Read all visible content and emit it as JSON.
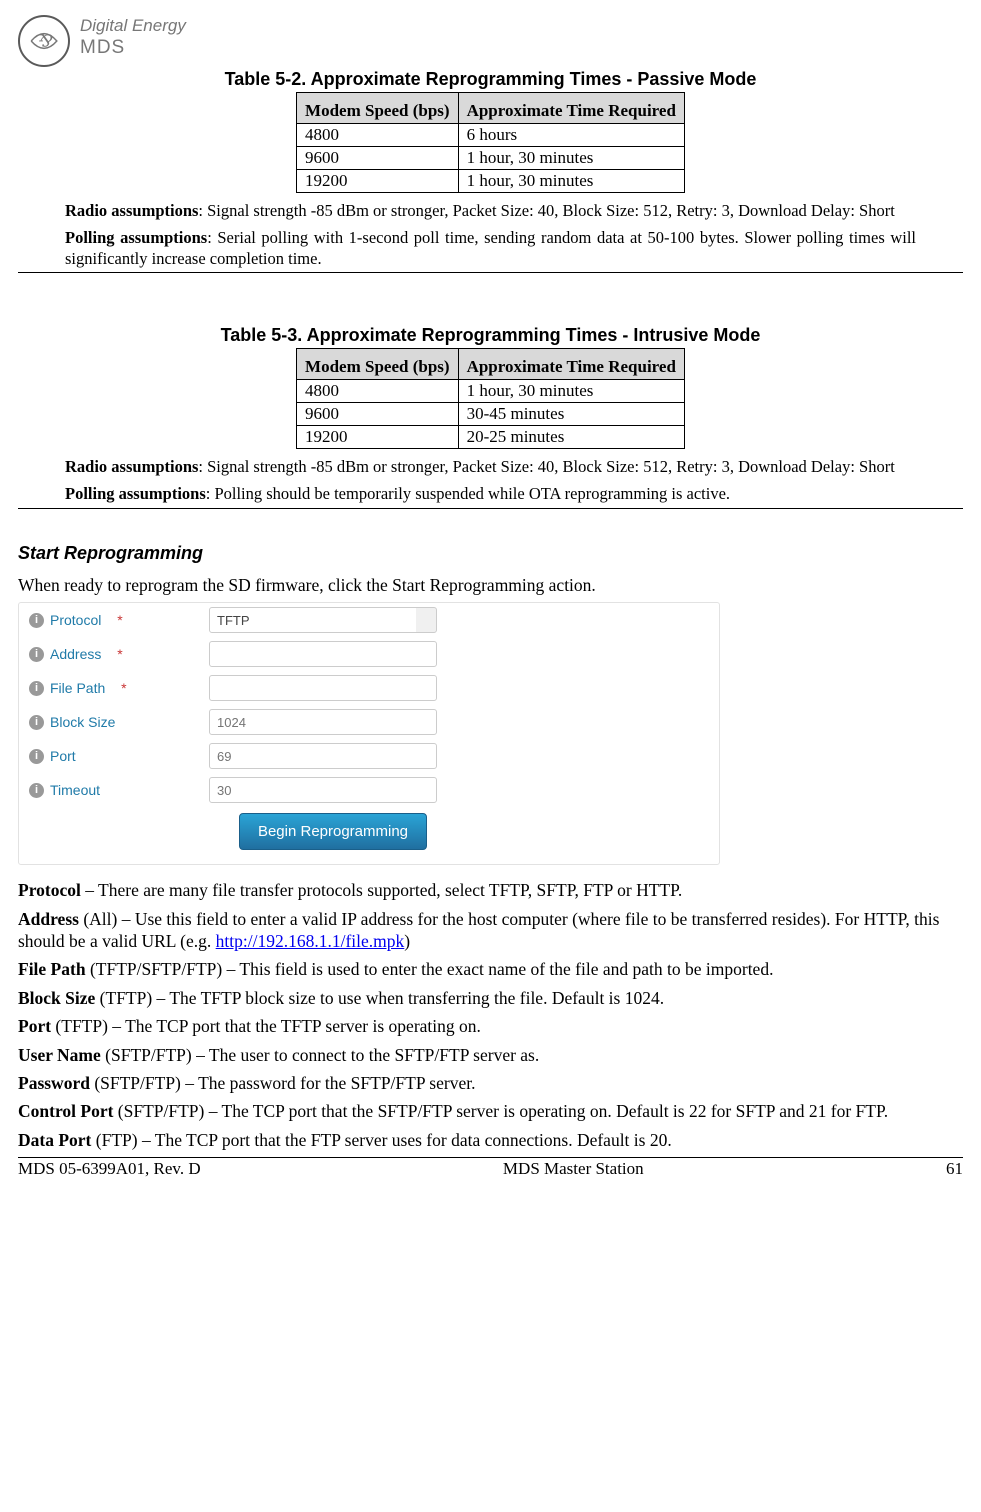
{
  "logo": {
    "line1": "Digital Energy",
    "line2": "MDS",
    "ge_mono": ""
  },
  "table52": {
    "caption": "Table 5-2. Approximate Reprogramming Times - Passive Mode",
    "head": {
      "c1": "Modem Speed (bps)",
      "c2": "Approximate Time Required"
    },
    "rows": [
      {
        "c1": "4800",
        "c2": "6 hours"
      },
      {
        "c1": "9600",
        "c2": "1 hour, 30 minutes"
      },
      {
        "c1": "19200",
        "c2": "1 hour, 30 minutes"
      }
    ],
    "radio_label": "Radio assumptions",
    "radio_text": ": Signal strength -85 dBm or stronger, Packet Size: 40, Block Size: 512, Retry: 3, Download Delay: Short",
    "polling_label": "Polling assumptions",
    "polling_text": ": Serial polling with 1-second poll time, sending random data at 50-100 bytes. Slower polling times will significantly increase completion time."
  },
  "table53": {
    "caption": "Table 5-3. Approximate Reprogramming Times - Intrusive Mode",
    "head": {
      "c1": "Modem Speed (bps)",
      "c2": "Approximate Time Required"
    },
    "rows": [
      {
        "c1": "4800",
        "c2": "1 hour, 30 minutes"
      },
      {
        "c1": "9600",
        "c2": "30-45 minutes"
      },
      {
        "c1": "19200",
        "c2": "20-25 minutes"
      }
    ],
    "radio_label": "Radio assumptions",
    "radio_text": ": Signal strength -85 dBm or stronger, Packet Size: 40, Block Size: 512, Retry: 3, Download Delay: Short",
    "polling_label": "Polling assumptions",
    "polling_text": ": Polling should be temporarily suspended while OTA reprogramming is active."
  },
  "start": {
    "heading": "Start Reprogramming",
    "intro": "When ready to reprogram the SD firmware, click the Start Reprogramming action."
  },
  "form": {
    "protocol": {
      "label": "Protocol",
      "value": "TFTP"
    },
    "address": {
      "label": "Address",
      "value": ""
    },
    "filepath": {
      "label": "File Path",
      "value": ""
    },
    "blocksize": {
      "label": "Block Size",
      "value": "1024"
    },
    "port": {
      "label": "Port",
      "value": "69"
    },
    "timeout": {
      "label": "Timeout",
      "value": "30"
    },
    "button": "Begin Reprogramming"
  },
  "defs": {
    "protocol": {
      "t": "Protocol",
      "d": " – There are many file transfer protocols supported, select TFTP, SFTP, FTP or HTTP."
    },
    "address": {
      "t": "Address",
      "q": " (All) – Use this field to enter a valid IP address for the host computer (where file to be transferred resides). For HTTP, this should be a valid URL (e.g. ",
      "link": "http://192.168.1.1/file.mpk",
      "tail": ")"
    },
    "filepath": {
      "t": "File Path",
      "d": " (TFTP/SFTP/FTP) – This field is used to enter the exact name of the file and path to be imported."
    },
    "blocksize": {
      "t": "Block Size",
      "d": " (TFTP) – The TFTP block size to use when transferring the file. Default is 1024."
    },
    "port": {
      "t": "Port",
      "d": " (TFTP) – The TCP port that the TFTP server is operating on."
    },
    "username": {
      "t": "User Name",
      "d": " (SFTP/FTP) – The user to connect to the SFTP/FTP server as."
    },
    "password": {
      "t": "Password",
      "d": " (SFTP/FTP) – The password for the SFTP/FTP server."
    },
    "controlport": {
      "t": "Control Port",
      "d": " (SFTP/FTP) – The TCP port that the SFTP/FTP server is operating on. Default is 22 for SFTP and 21 for FTP."
    },
    "dataport": {
      "t": "Data Port",
      "d": " (FTP) – The TCP port that the FTP server uses for data connections. Default is 20."
    }
  },
  "footer": {
    "left": "MDS 05-6399A01, Rev. D",
    "center": "MDS Master Station",
    "right": "61"
  }
}
